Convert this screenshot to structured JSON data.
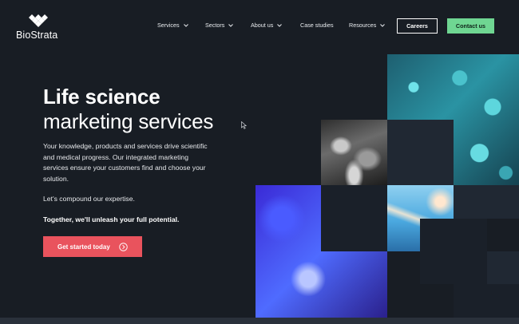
{
  "brand": {
    "name": "BioStrata"
  },
  "nav": {
    "items": [
      {
        "label": "Services",
        "has_dropdown": true
      },
      {
        "label": "Sectors",
        "has_dropdown": true
      },
      {
        "label": "About us",
        "has_dropdown": true
      },
      {
        "label": "Case studies",
        "has_dropdown": false
      },
      {
        "label": "Resources",
        "has_dropdown": true
      }
    ],
    "careers_label": "Careers",
    "contact_label": "Contact us"
  },
  "hero": {
    "title_bold": "Life science",
    "title_light": "marketing services",
    "paragraph": "Your knowledge, products and services drive scientific and medical progress. Our integrated marketing services ensure your customers find and choose your solution.",
    "line2": "Let's compound our expertise.",
    "line3": "Together, we'll unleash your full potential.",
    "cta_label": "Get started today"
  },
  "colors": {
    "background": "#181d24",
    "cta": "#e9535d",
    "contact": "#6fd692"
  },
  "icons": [
    "logo-diamonds-icon",
    "chevron-down-icon",
    "arrow-right-circle-icon",
    "mouse-cursor-icon"
  ]
}
